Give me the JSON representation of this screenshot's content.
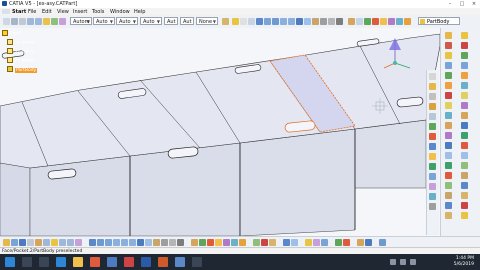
{
  "window": {
    "title": "CATIA V5 - [ex-asy.CATPart]"
  },
  "menu": [
    "Start",
    "File",
    "Edit",
    "View",
    "Insert",
    "Tools",
    "Window",
    "Help"
  ],
  "toolbar": {
    "combos": [
      {
        "value": "Autom"
      },
      {
        "value": "Auto"
      },
      {
        "value": "Auto"
      },
      {
        "value": "Auto"
      },
      {
        "value": "Aut"
      },
      {
        "value": "Aut"
      },
      {
        "value": "None"
      }
    ],
    "part_body": "PartBody"
  },
  "tree": {
    "root": "Part1",
    "items": [
      "xy plane",
      "yz plane",
      "zx plane",
      "PartBody"
    ]
  },
  "status": {
    "text": "Face/Pocket.2/PartBody preselected"
  },
  "taskbar": {
    "time": "1:44 PM",
    "date": "5/6/2019"
  },
  "colors": {
    "accent": "#f49a2a",
    "viewport_bg": "#f4f6fa",
    "part_top": "#e3e6f1",
    "part_side": "#d7dbe8",
    "highlight": "#e46a1d"
  }
}
